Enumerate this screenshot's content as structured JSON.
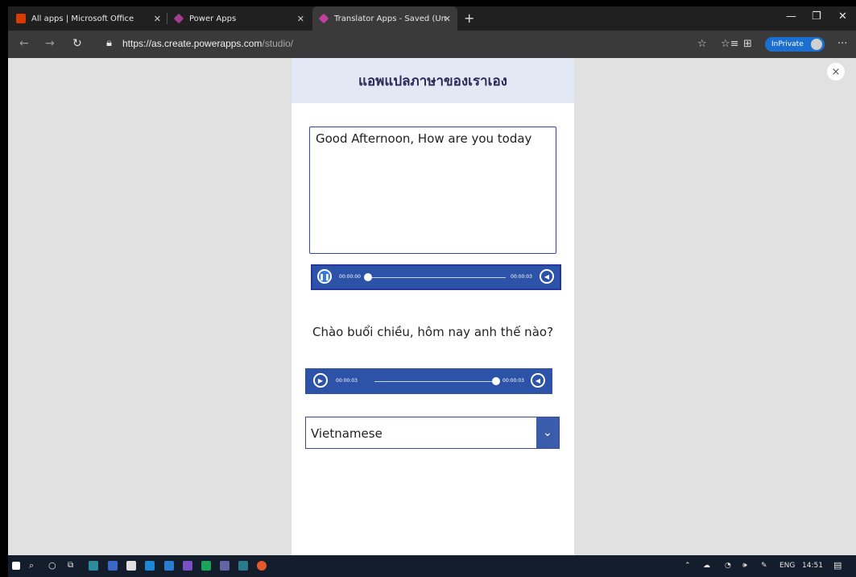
{
  "browser": {
    "tabs": [
      {
        "title": "All apps | Microsoft Office",
        "favicon": "office-icon"
      },
      {
        "title": "Power Apps",
        "favicon": "powerapps-icon"
      },
      {
        "title": "Translator Apps - Saved (Unpubl",
        "favicon": "powerapps-icon"
      }
    ],
    "new_tab": "+",
    "address": {
      "host": "https://as.create.powerapps.com",
      "path": "/studio/"
    },
    "inprivate_label": "InPrivate",
    "more": "···"
  },
  "app": {
    "title": "แอพแปลภาษาของเราเอง",
    "input_text": "Good Afternoon, How are you today",
    "source_player": {
      "elapsed": "00:00:00",
      "duration": "00:00:03",
      "state": "playing"
    },
    "translated_text": "Chào buổi chiều, hôm nay anh thế nào?",
    "target_player": {
      "elapsed": "00:00:03",
      "duration": "00:00:03",
      "state": "paused"
    },
    "language": "Vietnamese"
  },
  "close_label": "×",
  "taskbar": {
    "language": "ENG",
    "time": "14:51"
  },
  "colors": {
    "header_bg": "#e2e9f4",
    "player_bg": "#2d53a8",
    "accent": "#3a5cab",
    "inprivate": "#1b6fd1"
  }
}
